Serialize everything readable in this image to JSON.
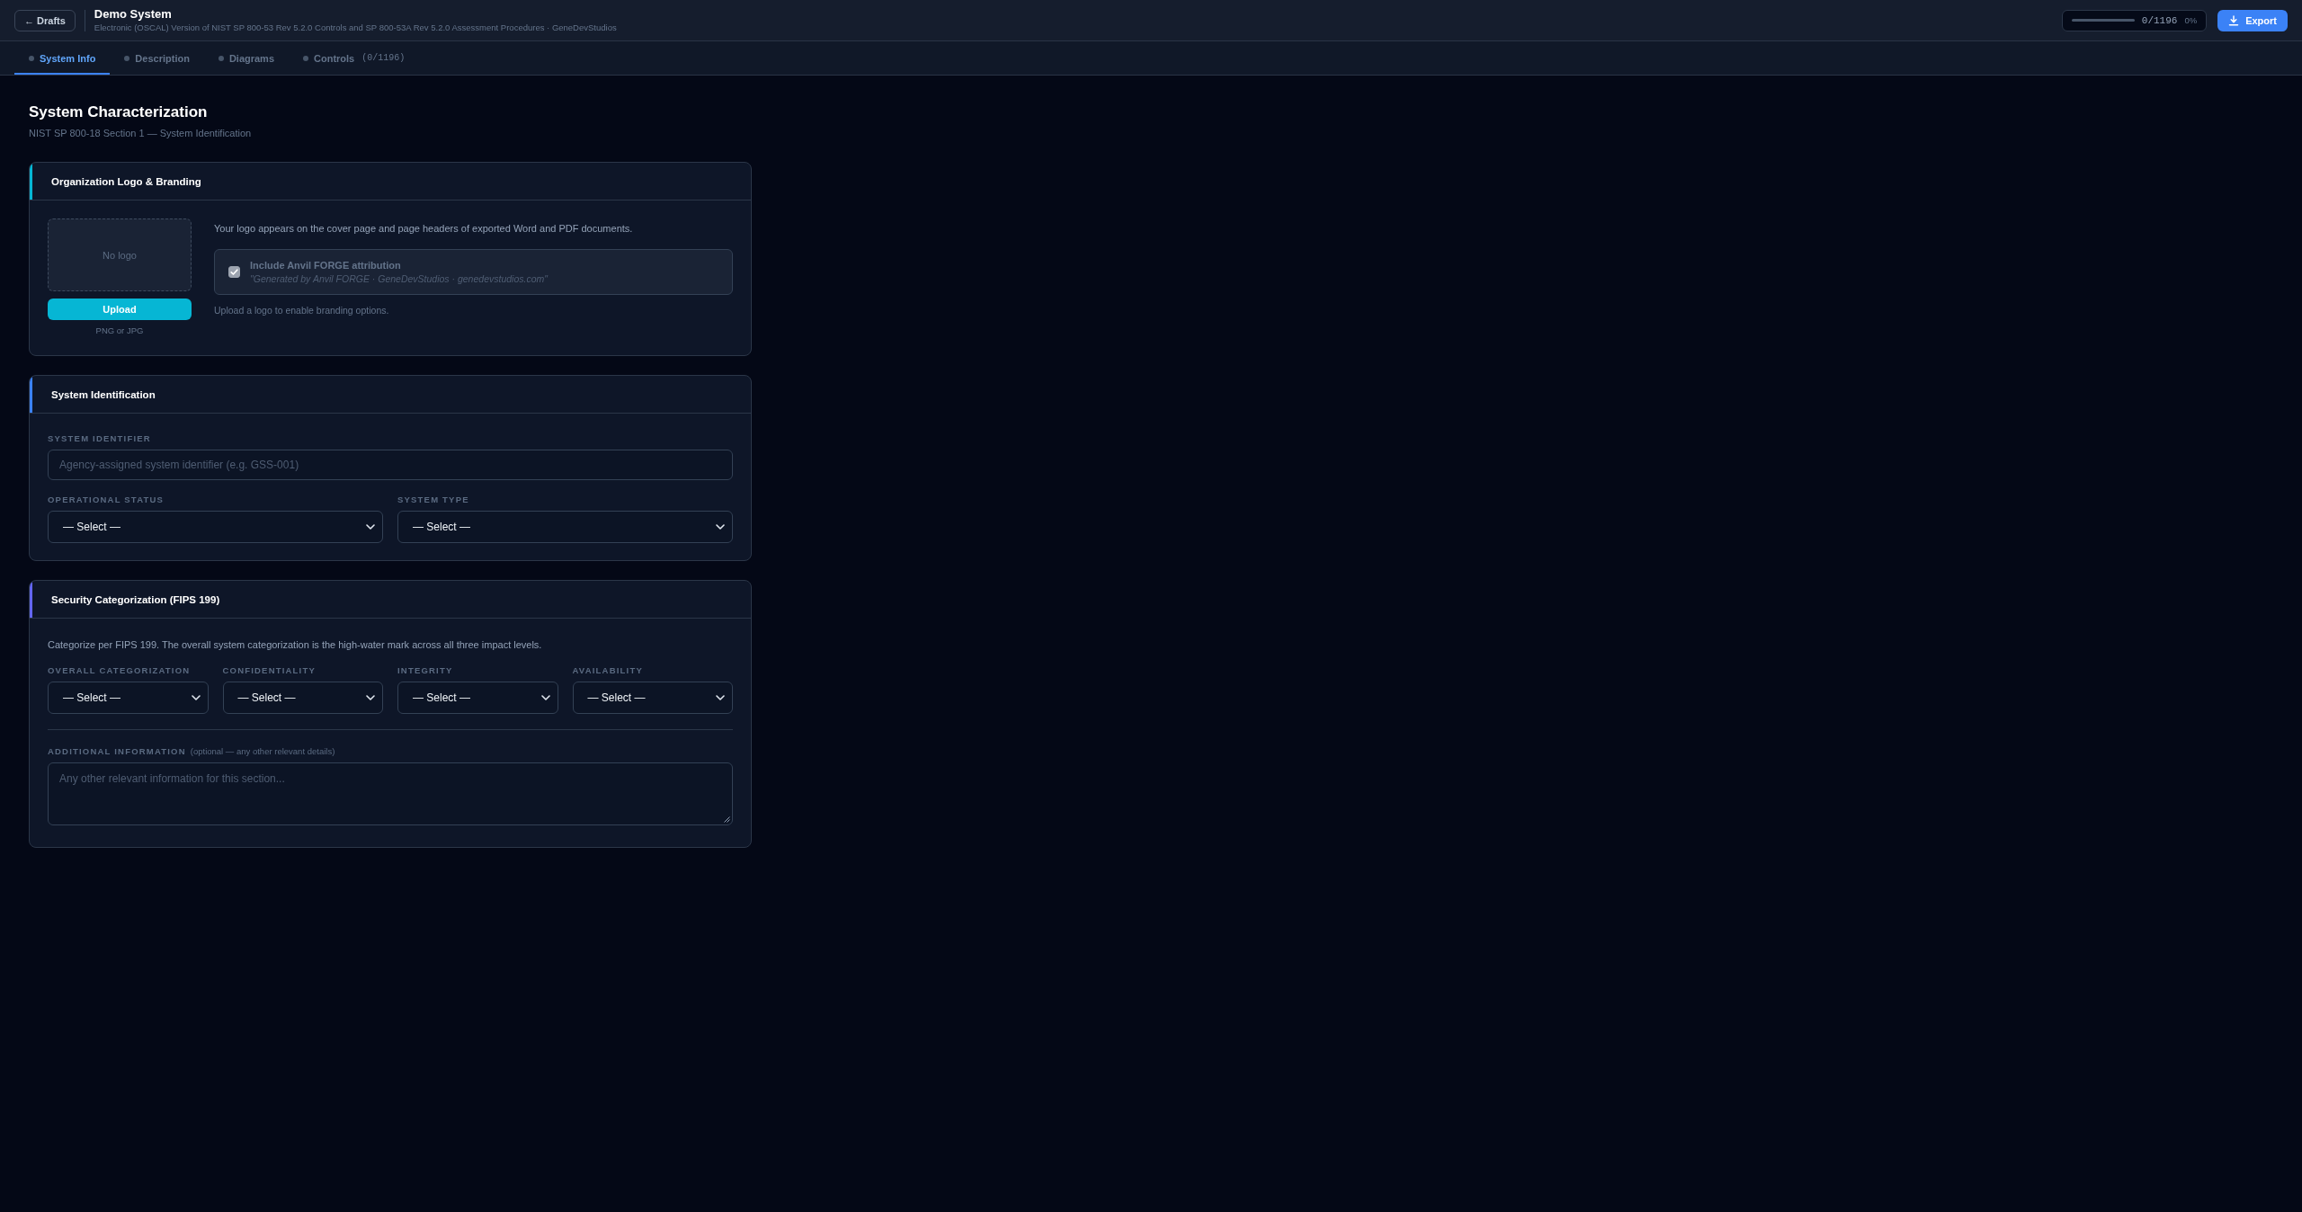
{
  "header": {
    "back_button": "← Drafts",
    "title": "Demo System",
    "subtitle": "Electronic (OSCAL) Version of NIST SP 800-53 Rev 5.2.0 Controls and SP 800-53A Rev 5.2.0 Assessment Procedures · GeneDevStudios",
    "progress": {
      "level": 0,
      "count": "0/1196",
      "percent": "0%"
    },
    "export_button": "Export"
  },
  "tabs": [
    {
      "label": "System Info",
      "selected": true
    },
    {
      "label": "Description",
      "selected": false
    },
    {
      "label": "Diagrams",
      "selected": false
    },
    {
      "label": "Controls",
      "count": "(0/1196)",
      "selected": false
    }
  ],
  "page": {
    "title": "System Characterization",
    "subtitle": "NIST SP 800-18 Section 1 — System Identification"
  },
  "sections": [
    {
      "kind": "branding",
      "title": "Organization Logo & Branding",
      "color": "#06b6d4",
      "logo_placeholder": "No logo",
      "upload_button": "Upload",
      "upload_hint": "PNG or JPG",
      "description": "Your logo appears on the cover page and page headers of exported Word and PDF documents.",
      "attribution": {
        "label": "Include Anvil FORGE attribution",
        "preview": "\"Generated by Anvil FORGE · GeneDevStudios · genedevstudios.com\"",
        "checked": true,
        "disabled": true
      },
      "note": "Upload a logo to enable branding options."
    },
    {
      "kind": "identification",
      "title": "System Identification",
      "color": "#3b82f6",
      "fields": [
        {
          "kind": "text",
          "label": "SYSTEM IDENTIFIER",
          "placeholder": "Agency-assigned system identifier (e.g. GSS-001)"
        },
        {
          "kind": "select",
          "label": "OPERATIONAL STATUS",
          "value": "— Select —"
        },
        {
          "kind": "select",
          "label": "SYSTEM TYPE",
          "value": "— Select —"
        }
      ]
    },
    {
      "kind": "categorization",
      "title": "Security Categorization (FIPS 199)",
      "color": "#6366f1",
      "description": "Categorize per FIPS 199. The overall system categorization is the high-water mark across all three impact levels.",
      "fields": [
        {
          "kind": "select",
          "label": "OVERALL CATEGORIZATION",
          "value": "— Select —"
        },
        {
          "kind": "select",
          "label": "CONFIDENTIALITY",
          "value": "— Select —"
        },
        {
          "kind": "select",
          "label": "INTEGRITY",
          "value": "— Select —"
        },
        {
          "kind": "select",
          "label": "AVAILABILITY",
          "value": "— Select —"
        }
      ],
      "notes": {
        "label": "ADDITIONAL INFORMATION",
        "hint": "(optional — any other relevant details)",
        "placeholder": "Any other relevant information for this section..."
      }
    }
  ]
}
